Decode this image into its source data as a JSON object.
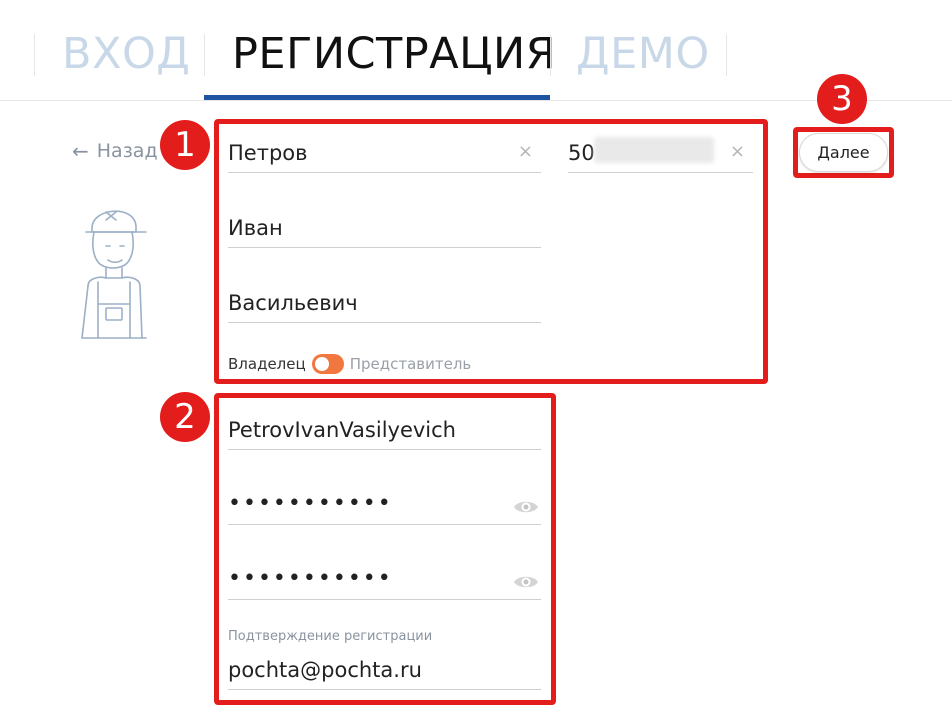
{
  "tabs": [
    {
      "label": "ВХОД"
    },
    {
      "label": "РЕГИСТРАЦИЯ"
    },
    {
      "label": "ДЕМО"
    }
  ],
  "back": {
    "label": "Назад",
    "arrow": "←"
  },
  "person": {
    "last_name": "Петров",
    "first_name": "Иван",
    "middle_name": "Васильевич",
    "phone_visible": "50"
  },
  "role_toggle": {
    "owner_label": "Владелец",
    "representative_label": "Представитель"
  },
  "account": {
    "login": "PetrovIvanVasilyevich",
    "password_mask": "•••••••••••",
    "password_confirm_mask": "•••••••••••",
    "email_label": "Подтверждение регистрации",
    "email": "pochta@pochta.ru"
  },
  "next_button": {
    "label": "Далее"
  },
  "annotations": {
    "badge1": "1",
    "badge2": "2",
    "badge3": "3"
  },
  "icons": {
    "clear": "×",
    "eye": "eye-icon",
    "back": "arrow-left-icon"
  },
  "colors": {
    "accent": "#1f55a0",
    "annotation": "#e31c1c",
    "toggle": "#f07840",
    "tab_inactive": "#c9d8e8"
  }
}
